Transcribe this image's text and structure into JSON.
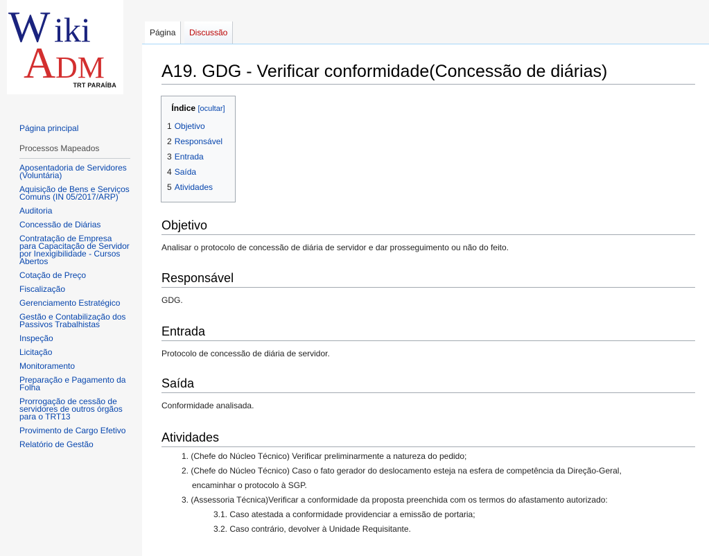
{
  "logo": {
    "tagline": "TRT PARAÍBA",
    "brand_color": "#1a237e",
    "accent_color": "#d32f2f"
  },
  "sidebar": {
    "main_link": "Página principal",
    "section_heading": "Processos Mapeados",
    "items": [
      "Aposentadoria de Servidores (Voluntária)",
      "Aquisição de Bens e Serviços Comuns (IN 05/2017/ARP)",
      "Auditoria",
      "Concessão de Diárias",
      "Contratação de Empresa para Capacitação de Servidor por Inexigibilidade - Cursos Abertos",
      "Cotação de Preço",
      "Fiscalização",
      "Gerenciamento Estratégico",
      "Gestão e Contabilização dos Passivos Trabalhistas",
      "Inspeção",
      "Licitação",
      "Monitoramento",
      "Preparação e Pagamento da Folha",
      "Prorrogação de cessão de servidores de outros órgãos para o TRT13",
      "Provimento de Cargo Efetivo",
      "Relatório de Gestão"
    ]
  },
  "tabs": {
    "page": "Página",
    "discussion": "Discussão"
  },
  "article": {
    "title": "A19. GDG - Verificar conformidade(Concessão de diárias)",
    "toc": {
      "heading": "Índice",
      "toggle": "[ocultar]",
      "items": [
        {
          "num": "1",
          "label": "Objetivo"
        },
        {
          "num": "2",
          "label": "Responsável"
        },
        {
          "num": "3",
          "label": "Entrada"
        },
        {
          "num": "4",
          "label": "Saída"
        },
        {
          "num": "5",
          "label": "Atividades"
        }
      ]
    },
    "sections": {
      "objetivo": {
        "heading": "Objetivo",
        "text": "Analisar o protocolo de concessão de diária de servidor e dar prosseguimento ou não do feito."
      },
      "responsavel": {
        "heading": "Responsável",
        "text": "GDG."
      },
      "entrada": {
        "heading": "Entrada",
        "text": "Protocolo de concessão de diária de servidor."
      },
      "saida": {
        "heading": "Saída",
        "text": "Conformidade analisada."
      },
      "atividades": {
        "heading": "Atividades",
        "items": [
          "1. (Chefe do Núcleo Técnico) Verificar preliminarmente a natureza do pedido;",
          "2. (Chefe do Núcleo Técnico) Caso o fato gerador do deslocamento esteja na esfera de competência da Direção-Geral,",
          "encaminhar o protocolo à SGP.",
          "3. (Assessoria Técnica)Verificar a conformidade da proposta preenchida com os termos do afastamento autorizado:",
          "3.1. Caso atestada a conformidade providenciar a emissão de portaria;",
          "3.2. Caso contrário, devolver à Unidade Requisitante."
        ]
      }
    }
  }
}
